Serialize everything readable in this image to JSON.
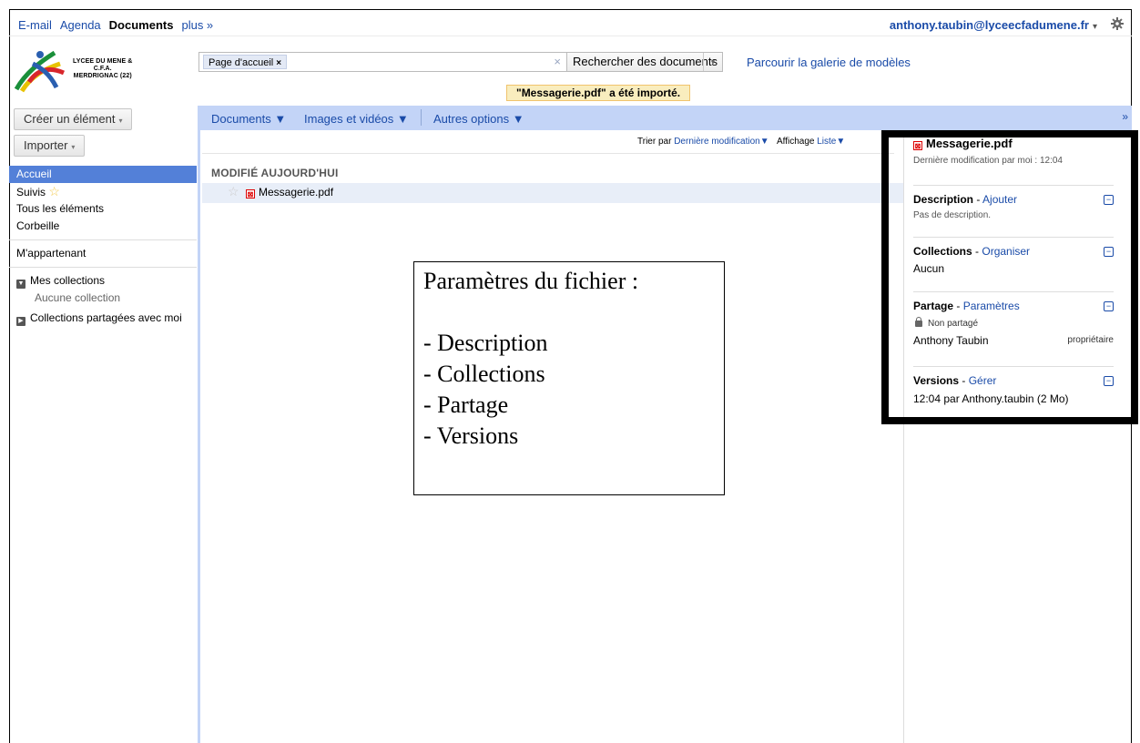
{
  "topnav": {
    "email": "E-mail",
    "agenda": "Agenda",
    "documents": "Documents",
    "more": "plus »"
  },
  "account": {
    "email": "anthony.taubin@lyceecfadumene.fr",
    "caret": "▾"
  },
  "logo": {
    "line1": "LYCEE DU MENE &",
    "line2": "C.F.A.",
    "line3": "MERDRIGNAC (22)"
  },
  "search": {
    "chip_label": "Page d'accueil",
    "chip_close": "×",
    "clear": "×",
    "button_label": "Rechercher des documents",
    "button_caret": "▾",
    "gallery_link": "Parcourir la galerie de modèles"
  },
  "notification": "\"Messagerie.pdf\" a été importé.",
  "left": {
    "create_button": "Créer un élément",
    "import_button": "Importer",
    "caret": "▾",
    "nav": [
      {
        "label": "Accueil"
      },
      {
        "label": "Suivis"
      },
      {
        "label": "Tous les éléments"
      },
      {
        "label": "Corbeille"
      }
    ],
    "mine": "M'appartenant",
    "my_collections": "Mes collections",
    "no_collection": "Aucune collection",
    "shared_collections": "Collections partagées avec moi"
  },
  "toolbar": {
    "documents": "Documents ▼",
    "images": "Images et vidéos ▼",
    "other": "Autres options ▼",
    "collapse": "»"
  },
  "sort": {
    "sort_prefix": "Trier par",
    "sort_value": "Dernière modification▼",
    "view_prefix": "Affichage",
    "view_value": "Liste▼"
  },
  "main": {
    "section_heading": "MODIFIÉ AUJOURD'HUI",
    "file_name": "Messagerie.pdf"
  },
  "annotation": {
    "title": "Paramètres du fichier :",
    "items": [
      "- Description",
      "- Collections",
      "- Partage",
      "- Versions"
    ]
  },
  "details": {
    "file_name": "Messagerie.pdf",
    "modified": "Dernière modification par moi : 12:04",
    "description_label": "Description",
    "description_action": "Ajouter",
    "description_value": "Pas de description.",
    "collections_label": "Collections",
    "collections_action": "Organiser",
    "collections_value": "Aucun",
    "sharing_label": "Partage",
    "sharing_action": "Paramètres",
    "sharing_status": "Non partagé",
    "owner_name": "Anthony Taubin",
    "owner_role": "propriétaire",
    "versions_label": "Versions",
    "versions_action": "Gérer",
    "versions_value": "12:04 par Anthony.taubin (2 Mo)",
    "separator": " - ",
    "minus": "−"
  },
  "colors": {
    "accent_blue": "#1a4ba8",
    "toolbar_bg": "#c3d4f7",
    "selection": "#5380d8",
    "notice_bg": "#f9edbe"
  }
}
